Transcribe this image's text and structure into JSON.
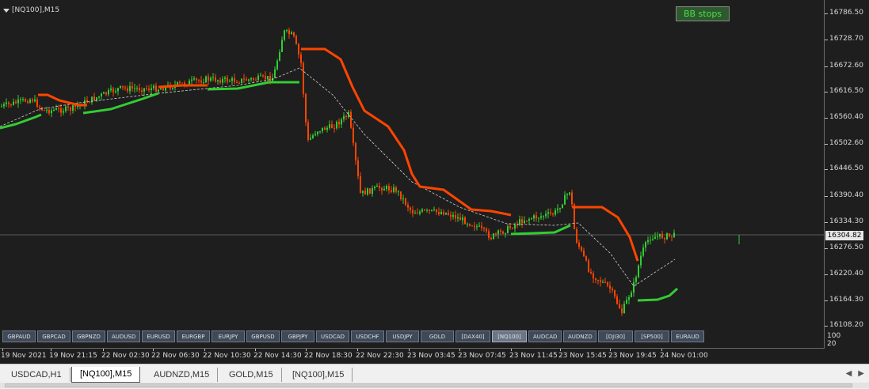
{
  "chart": {
    "symbol_title": "[NQ100],M15",
    "indicator_label": "BB stops",
    "current_price": "16304.82",
    "price_ticks": [
      "16786.50",
      "16728.70",
      "16672.60",
      "16616.50",
      "16560.40",
      "16502.60",
      "16446.50",
      "16390.40",
      "16334.30",
      "16276.50",
      "16220.40",
      "16164.30",
      "16108.20"
    ],
    "indicator_scale": [
      "100",
      "20"
    ],
    "time_labels": [
      "19 Nov 2021",
      "19 Nov 21:15",
      "22 Nov 02:30",
      "22 Nov 06:30",
      "22 Nov 10:30",
      "22 Nov 14:30",
      "22 Nov 18:30",
      "22 Nov 22:30",
      "23 Nov 03:45",
      "23 Nov 07:45",
      "23 Nov 11:45",
      "23 Nov 15:45",
      "23 Nov 19:45",
      "24 Nov 01:00"
    ],
    "colors": {
      "bull": "#33cc33",
      "bear": "#ff4500",
      "stop_up": "#33cc33",
      "stop_down": "#ff4500",
      "midline": "#cfcfcf"
    }
  },
  "symbol_buttons": [
    "GBPAUD",
    "GBPCAD",
    "GBPNZD",
    "AUDUSD",
    "EURUSD",
    "EURGBP",
    "EURJPY",
    "GBPUSD",
    "GBPJPY",
    "USDCAD",
    "USDCHF",
    "USDJPY",
    "GOLD",
    "[DAX40]",
    "[NQ100]",
    "AUDCAD",
    "AUDNZD",
    "[DJI30]",
    "[SP500]",
    "EURAUD"
  ],
  "active_symbol": "[NQ100]",
  "tabs": [
    "USDCAD,H1",
    "[NQ100],M15",
    "AUDNZD,M15",
    "GOLD,M15",
    "[NQ100],M15"
  ],
  "active_tab_index": 1,
  "chart_data": {
    "type": "candlestick",
    "title": "[NQ100],M15",
    "x": [
      "19 Nov 2021",
      "19 Nov 21:15",
      "22 Nov 02:30",
      "22 Nov 06:30",
      "22 Nov 10:30",
      "22 Nov 14:30",
      "22 Nov 18:30",
      "22 Nov 22:30",
      "23 Nov 03:45",
      "23 Nov 07:45",
      "23 Nov 11:45",
      "23 Nov 15:45",
      "23 Nov 19:45",
      "24 Nov 01:00"
    ],
    "close_approx": [
      16600,
      16595,
      16620,
      16625,
      16640,
      16780,
      16540,
      16400,
      16330,
      16300,
      16330,
      16190,
      16300,
      16305
    ],
    "ylim": [
      16108.2,
      16786.5
    ],
    "series": [
      {
        "name": "BB stops",
        "values": []
      }
    ]
  }
}
